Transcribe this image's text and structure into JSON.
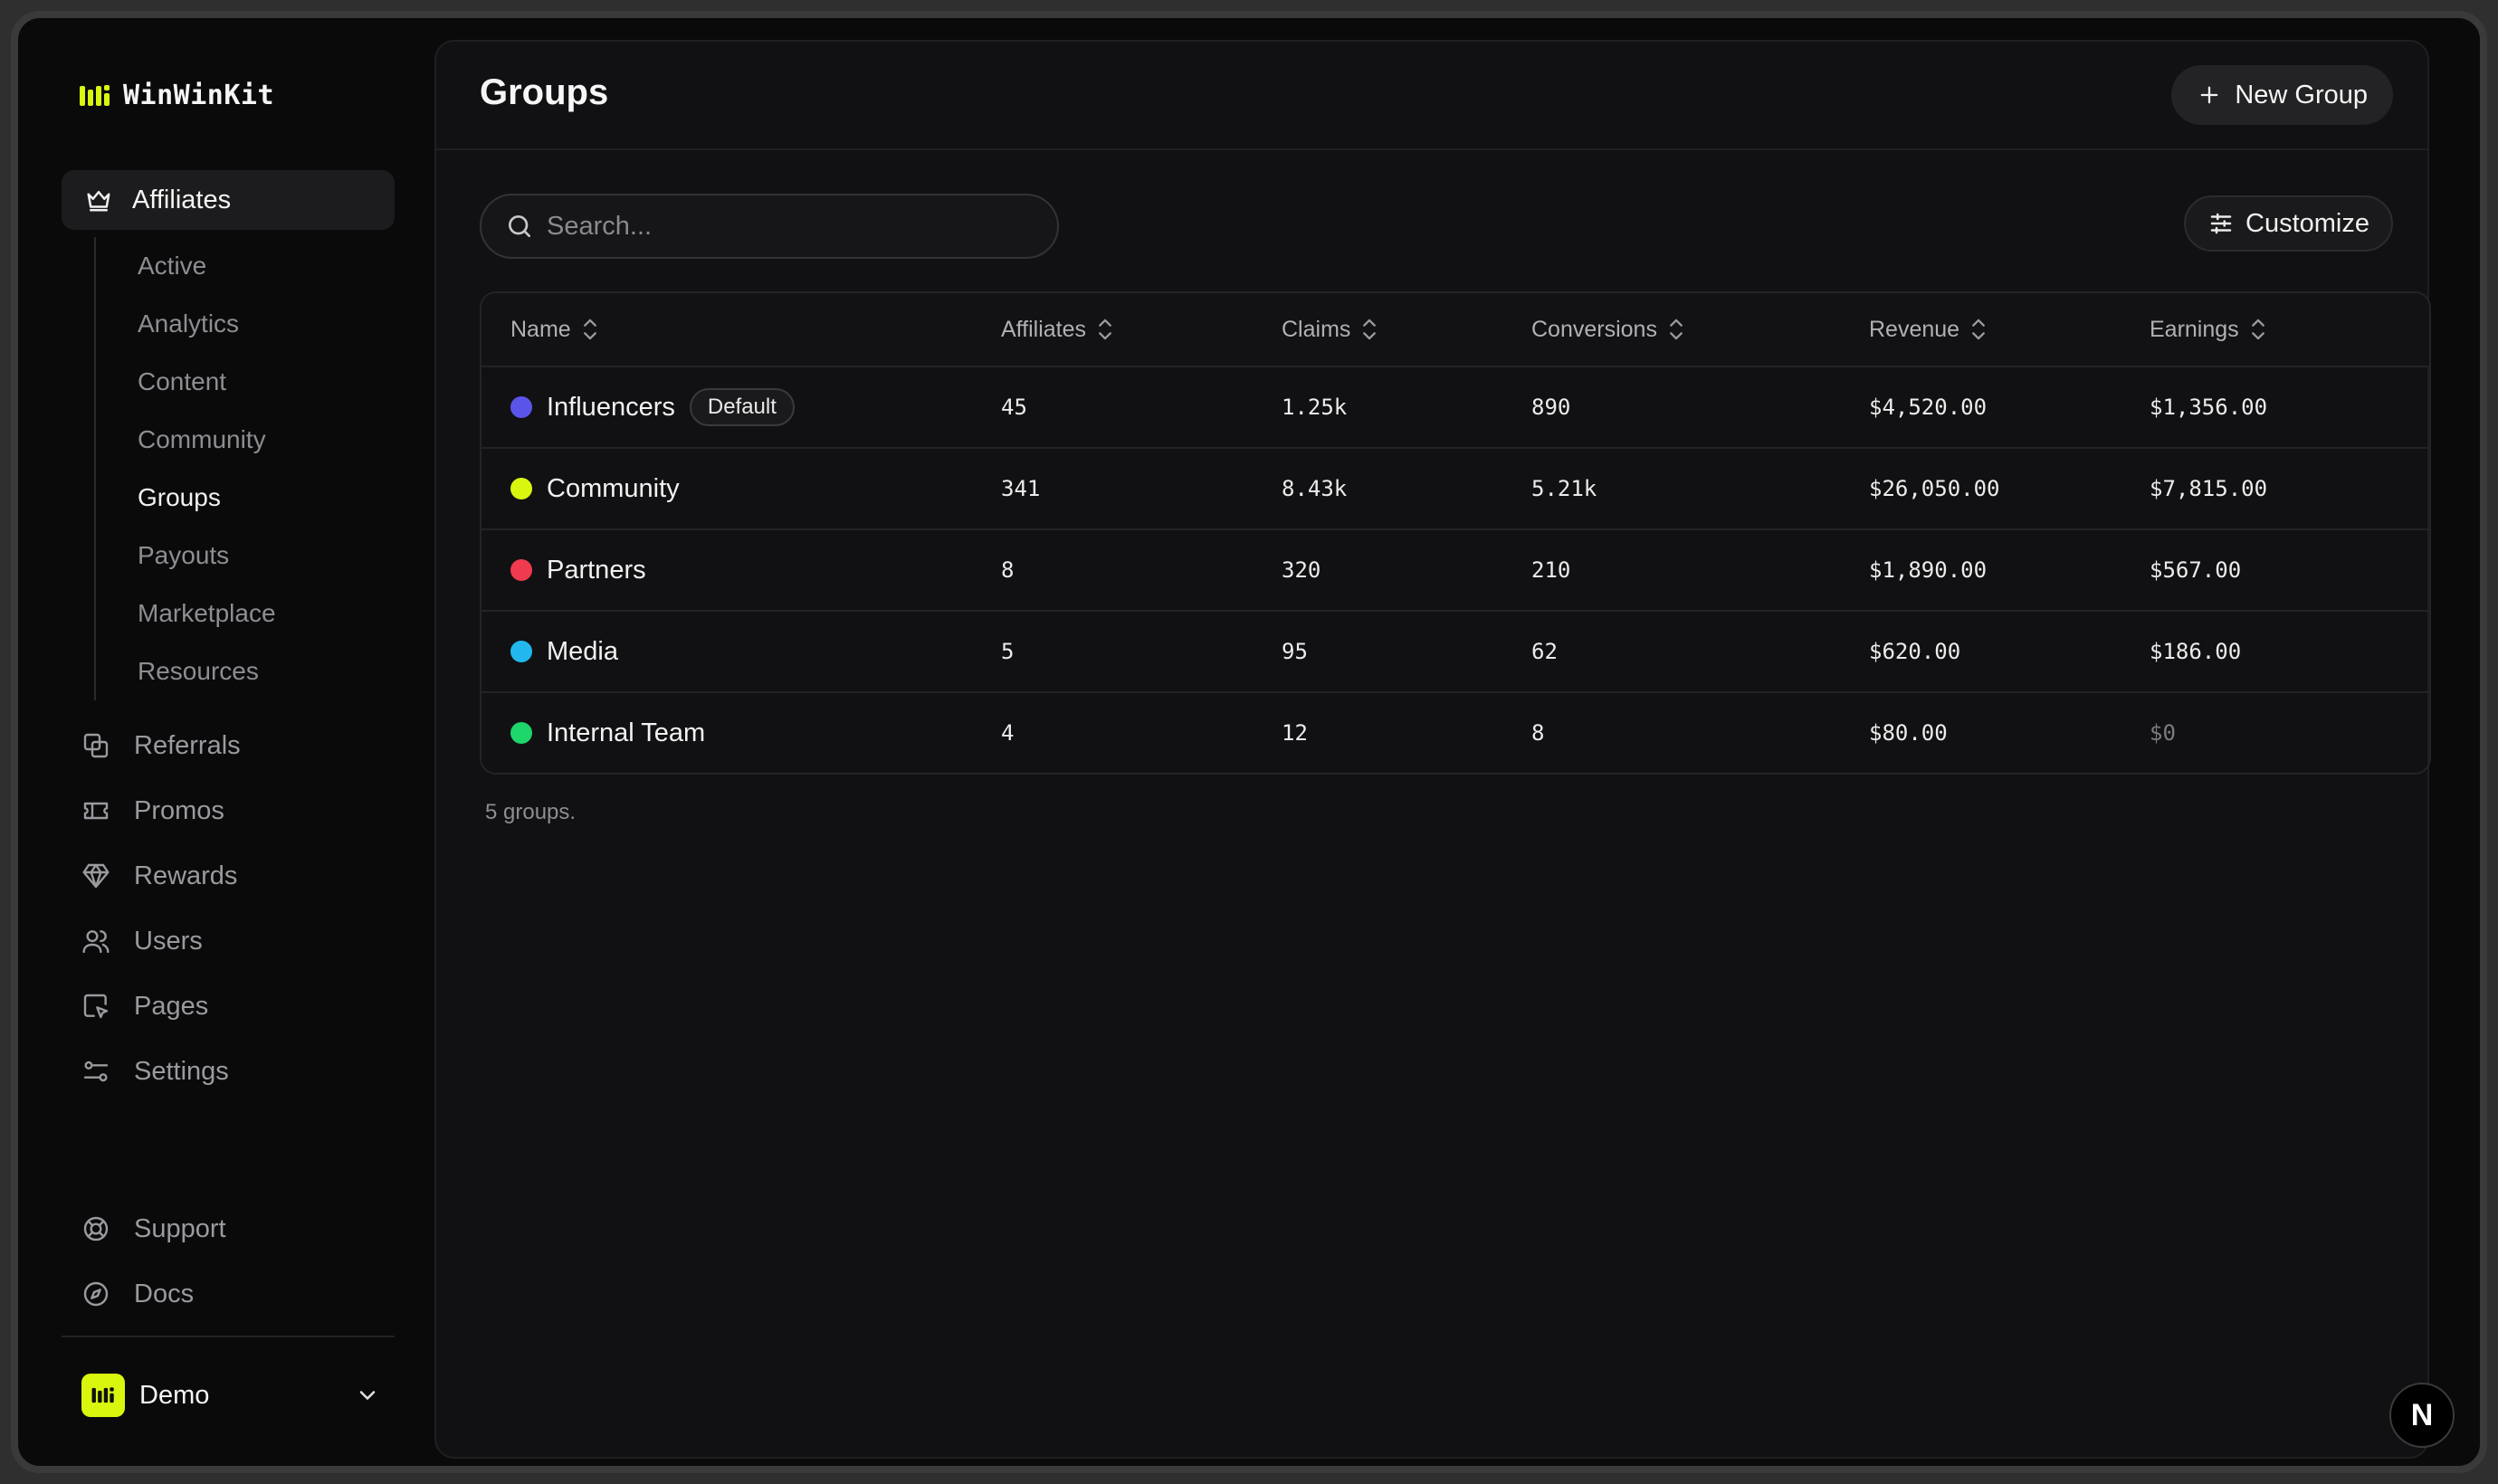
{
  "brand": {
    "name": "WinWinKit",
    "logo_icon": "winwinkit-logo-icon",
    "accent": "#d9f70e"
  },
  "sidebar": {
    "main_item": {
      "label": "Affiliates",
      "icon": "crown-icon"
    },
    "sub_items": [
      {
        "label": "Active"
      },
      {
        "label": "Analytics"
      },
      {
        "label": "Content"
      },
      {
        "label": "Community"
      },
      {
        "label": "Groups",
        "active": true
      },
      {
        "label": "Payouts"
      },
      {
        "label": "Marketplace"
      },
      {
        "label": "Resources"
      }
    ],
    "items": [
      {
        "label": "Referrals",
        "icon": "referrals-icon"
      },
      {
        "label": "Promos",
        "icon": "ticket-icon"
      },
      {
        "label": "Rewards",
        "icon": "gem-icon"
      },
      {
        "label": "Users",
        "icon": "users-icon"
      },
      {
        "label": "Pages",
        "icon": "page-cursor-icon"
      },
      {
        "label": "Settings",
        "icon": "settings-sliders-icon"
      }
    ],
    "bottom_items": [
      {
        "label": "Support",
        "icon": "lifebuoy-icon"
      },
      {
        "label": "Docs",
        "icon": "compass-icon"
      }
    ],
    "workspace": {
      "name": "Demo",
      "icon": "chevron-down-icon"
    }
  },
  "header": {
    "title": "Groups",
    "new_button": "New Group"
  },
  "toolbar": {
    "search_placeholder": "Search...",
    "customize_label": "Customize"
  },
  "table": {
    "columns": [
      "Name",
      "Affiliates",
      "Claims",
      "Conversions",
      "Revenue",
      "Earnings"
    ],
    "rows": [
      {
        "name": "Influencers",
        "color": "#5b54e8",
        "badge": "Default",
        "affiliates": "45",
        "claims": "1.25k",
        "conversions": "890",
        "revenue": "$4,520.00",
        "earnings": "$1,356.00"
      },
      {
        "name": "Community",
        "color": "#d9f70e",
        "badge": "",
        "affiliates": "341",
        "claims": "8.43k",
        "conversions": "5.21k",
        "revenue": "$26,050.00",
        "earnings": "$7,815.00"
      },
      {
        "name": "Partners",
        "color": "#ef3a4f",
        "badge": "",
        "affiliates": "8",
        "claims": "320",
        "conversions": "210",
        "revenue": "$1,890.00",
        "earnings": "$567.00"
      },
      {
        "name": "Media",
        "color": "#22b8ee",
        "badge": "",
        "affiliates": "5",
        "claims": "95",
        "conversions": "62",
        "revenue": "$620.00",
        "earnings": "$186.00"
      },
      {
        "name": "Internal Team",
        "color": "#1ed66a",
        "badge": "",
        "affiliates": "4",
        "claims": "12",
        "conversions": "8",
        "revenue": "$80.00",
        "earnings": "$0"
      }
    ],
    "footer": "5 groups."
  },
  "corner_badge": {
    "label": "N"
  }
}
